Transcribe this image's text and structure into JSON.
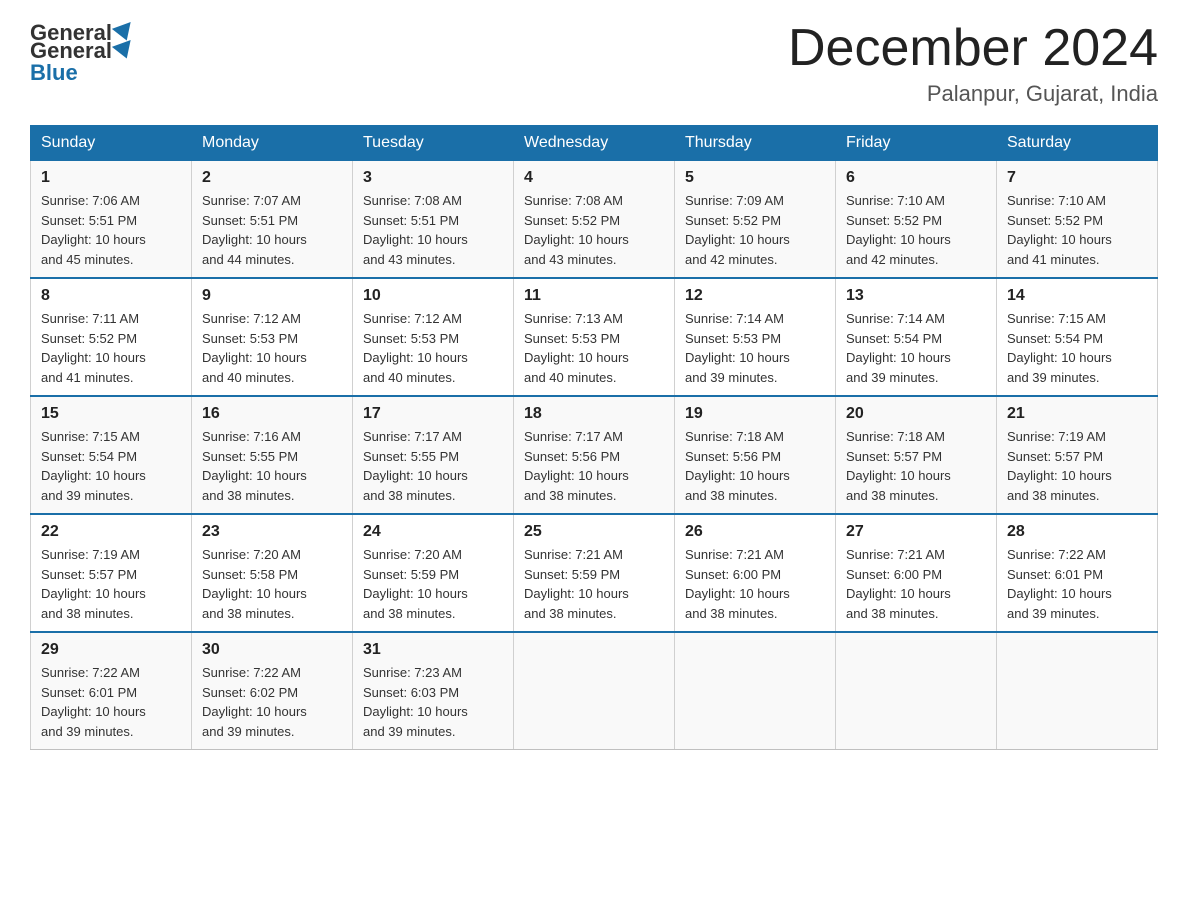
{
  "logo": {
    "general": "General",
    "blue": "Blue"
  },
  "title": {
    "month_year": "December 2024",
    "location": "Palanpur, Gujarat, India"
  },
  "weekdays": [
    "Sunday",
    "Monday",
    "Tuesday",
    "Wednesday",
    "Thursday",
    "Friday",
    "Saturday"
  ],
  "weeks": [
    [
      {
        "day": "1",
        "sunrise": "7:06 AM",
        "sunset": "5:51 PM",
        "daylight": "10 hours and 45 minutes."
      },
      {
        "day": "2",
        "sunrise": "7:07 AM",
        "sunset": "5:51 PM",
        "daylight": "10 hours and 44 minutes."
      },
      {
        "day": "3",
        "sunrise": "7:08 AM",
        "sunset": "5:51 PM",
        "daylight": "10 hours and 43 minutes."
      },
      {
        "day": "4",
        "sunrise": "7:08 AM",
        "sunset": "5:52 PM",
        "daylight": "10 hours and 43 minutes."
      },
      {
        "day": "5",
        "sunrise": "7:09 AM",
        "sunset": "5:52 PM",
        "daylight": "10 hours and 42 minutes."
      },
      {
        "day": "6",
        "sunrise": "7:10 AM",
        "sunset": "5:52 PM",
        "daylight": "10 hours and 42 minutes."
      },
      {
        "day": "7",
        "sunrise": "7:10 AM",
        "sunset": "5:52 PM",
        "daylight": "10 hours and 41 minutes."
      }
    ],
    [
      {
        "day": "8",
        "sunrise": "7:11 AM",
        "sunset": "5:52 PM",
        "daylight": "10 hours and 41 minutes."
      },
      {
        "day": "9",
        "sunrise": "7:12 AM",
        "sunset": "5:53 PM",
        "daylight": "10 hours and 40 minutes."
      },
      {
        "day": "10",
        "sunrise": "7:12 AM",
        "sunset": "5:53 PM",
        "daylight": "10 hours and 40 minutes."
      },
      {
        "day": "11",
        "sunrise": "7:13 AM",
        "sunset": "5:53 PM",
        "daylight": "10 hours and 40 minutes."
      },
      {
        "day": "12",
        "sunrise": "7:14 AM",
        "sunset": "5:53 PM",
        "daylight": "10 hours and 39 minutes."
      },
      {
        "day": "13",
        "sunrise": "7:14 AM",
        "sunset": "5:54 PM",
        "daylight": "10 hours and 39 minutes."
      },
      {
        "day": "14",
        "sunrise": "7:15 AM",
        "sunset": "5:54 PM",
        "daylight": "10 hours and 39 minutes."
      }
    ],
    [
      {
        "day": "15",
        "sunrise": "7:15 AM",
        "sunset": "5:54 PM",
        "daylight": "10 hours and 39 minutes."
      },
      {
        "day": "16",
        "sunrise": "7:16 AM",
        "sunset": "5:55 PM",
        "daylight": "10 hours and 38 minutes."
      },
      {
        "day": "17",
        "sunrise": "7:17 AM",
        "sunset": "5:55 PM",
        "daylight": "10 hours and 38 minutes."
      },
      {
        "day": "18",
        "sunrise": "7:17 AM",
        "sunset": "5:56 PM",
        "daylight": "10 hours and 38 minutes."
      },
      {
        "day": "19",
        "sunrise": "7:18 AM",
        "sunset": "5:56 PM",
        "daylight": "10 hours and 38 minutes."
      },
      {
        "day": "20",
        "sunrise": "7:18 AM",
        "sunset": "5:57 PM",
        "daylight": "10 hours and 38 minutes."
      },
      {
        "day": "21",
        "sunrise": "7:19 AM",
        "sunset": "5:57 PM",
        "daylight": "10 hours and 38 minutes."
      }
    ],
    [
      {
        "day": "22",
        "sunrise": "7:19 AM",
        "sunset": "5:57 PM",
        "daylight": "10 hours and 38 minutes."
      },
      {
        "day": "23",
        "sunrise": "7:20 AM",
        "sunset": "5:58 PM",
        "daylight": "10 hours and 38 minutes."
      },
      {
        "day": "24",
        "sunrise": "7:20 AM",
        "sunset": "5:59 PM",
        "daylight": "10 hours and 38 minutes."
      },
      {
        "day": "25",
        "sunrise": "7:21 AM",
        "sunset": "5:59 PM",
        "daylight": "10 hours and 38 minutes."
      },
      {
        "day": "26",
        "sunrise": "7:21 AM",
        "sunset": "6:00 PM",
        "daylight": "10 hours and 38 minutes."
      },
      {
        "day": "27",
        "sunrise": "7:21 AM",
        "sunset": "6:00 PM",
        "daylight": "10 hours and 38 minutes."
      },
      {
        "day": "28",
        "sunrise": "7:22 AM",
        "sunset": "6:01 PM",
        "daylight": "10 hours and 39 minutes."
      }
    ],
    [
      {
        "day": "29",
        "sunrise": "7:22 AM",
        "sunset": "6:01 PM",
        "daylight": "10 hours and 39 minutes."
      },
      {
        "day": "30",
        "sunrise": "7:22 AM",
        "sunset": "6:02 PM",
        "daylight": "10 hours and 39 minutes."
      },
      {
        "day": "31",
        "sunrise": "7:23 AM",
        "sunset": "6:03 PM",
        "daylight": "10 hours and 39 minutes."
      },
      null,
      null,
      null,
      null
    ]
  ],
  "labels": {
    "sunrise": "Sunrise:",
    "sunset": "Sunset:",
    "daylight": "Daylight:"
  }
}
